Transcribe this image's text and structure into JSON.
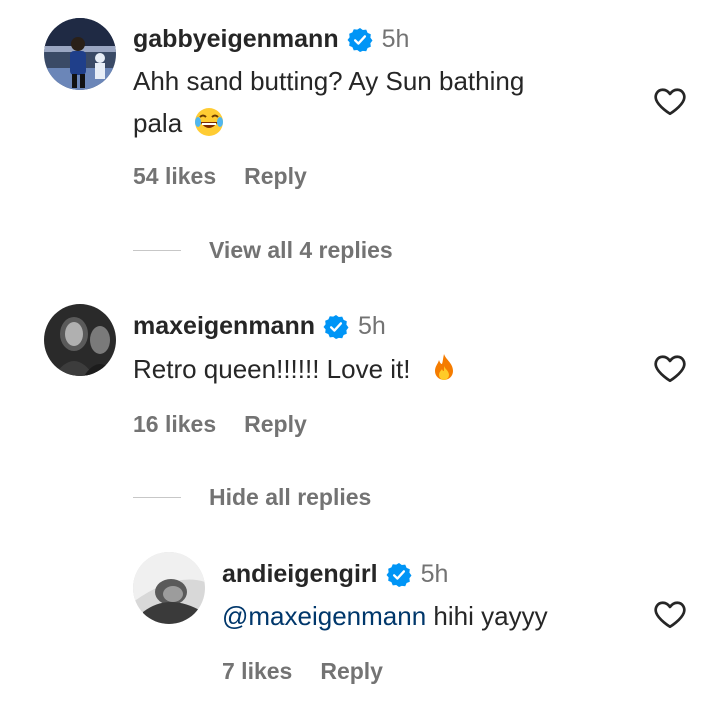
{
  "comments": [
    {
      "username": "gabbyeigenmann",
      "time": "5h",
      "text_line1": "Ahh sand butting? Ay Sun bathing",
      "text_line2": "pala",
      "emoji": "laughing-emoji",
      "likes": "54 likes",
      "reply": "Reply",
      "toggle": "View all 4 replies"
    },
    {
      "username": "maxeigenmann",
      "time": "5h",
      "text": "Retro queen!!!!!! Love it!",
      "emoji": "fire-emoji",
      "likes": "16 likes",
      "reply": "Reply",
      "toggle": "Hide all replies"
    }
  ],
  "reply": {
    "username": "andieigengirl",
    "time": "5h",
    "mention": "@maxeigenmann",
    "text": "hihi yayyy",
    "likes": "7 likes",
    "reply": "Reply"
  },
  "colors": {
    "verified": "#0095f6",
    "muted": "#737373",
    "mention": "#00376b"
  }
}
